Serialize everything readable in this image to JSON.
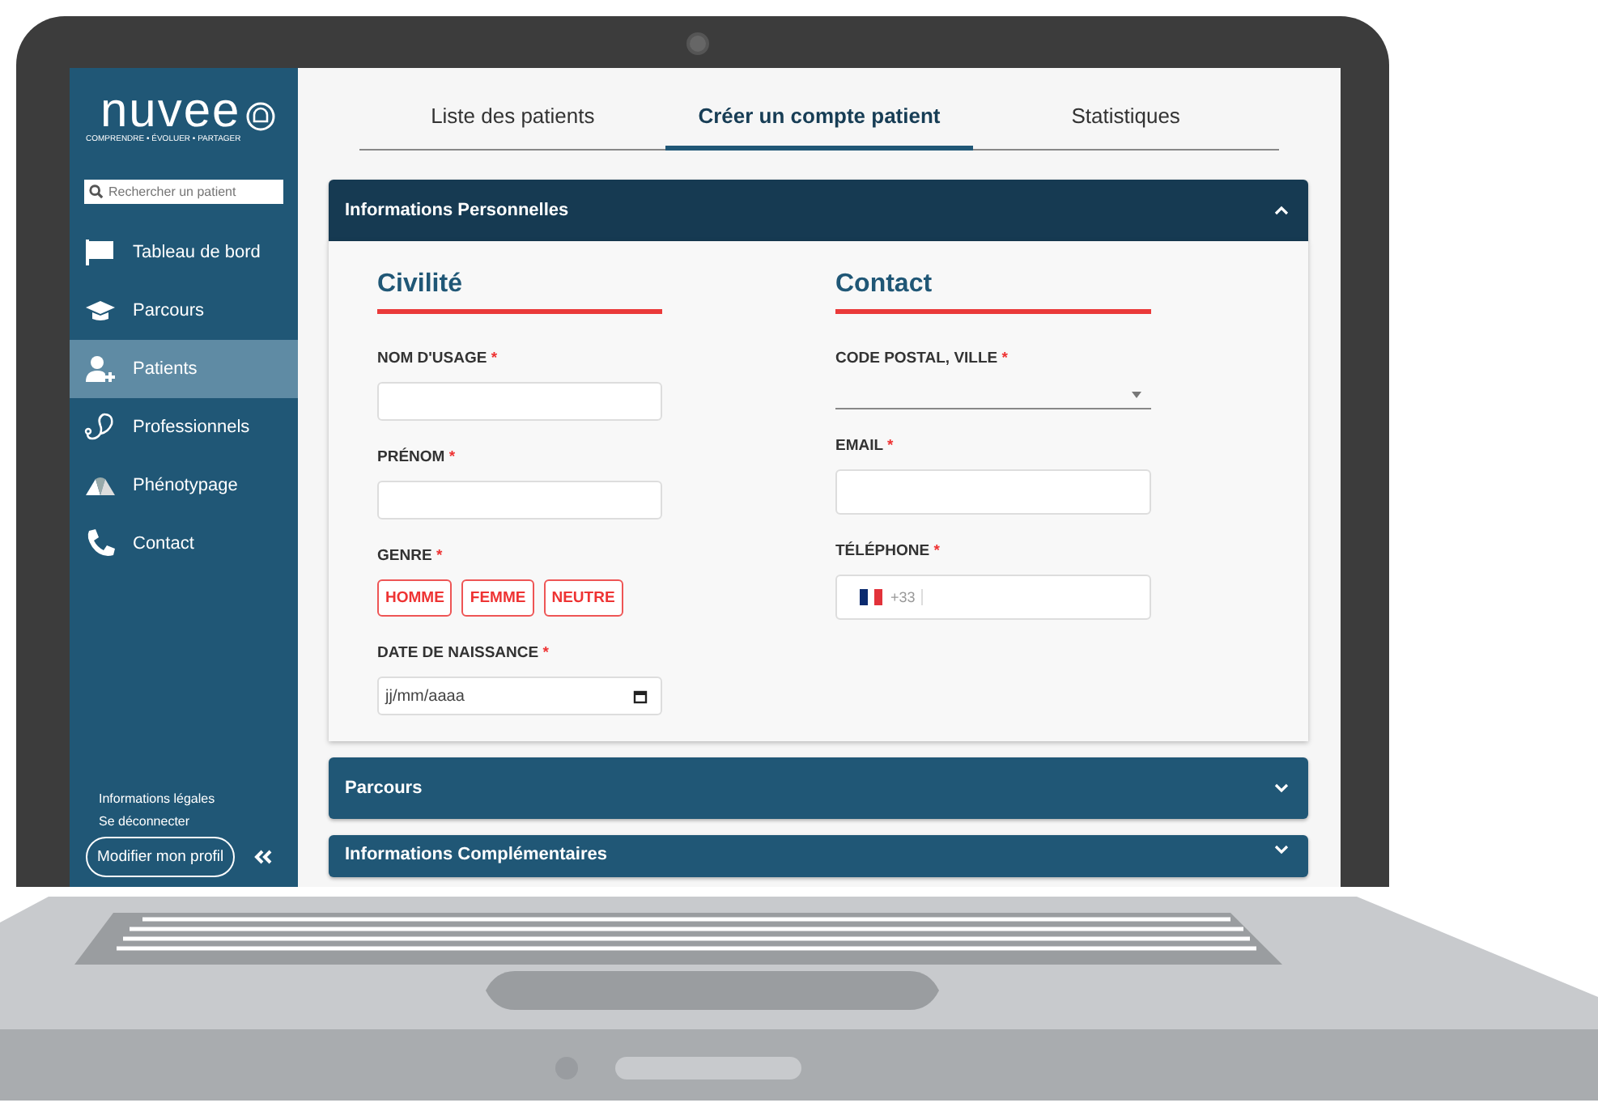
{
  "sidebar": {
    "logo": "nuvee",
    "tagline": "COMPRENDRE • ÉVOLUER • PARTAGER",
    "search": {
      "placeholder": "Rechercher un patient"
    },
    "items": [
      {
        "label": "Tableau de bord",
        "selected": false
      },
      {
        "label": "Parcours",
        "selected": false
      },
      {
        "label": "Patients",
        "selected": true
      },
      {
        "label": "Professionnels",
        "selected": false
      },
      {
        "label": "Phénotypage",
        "selected": false
      },
      {
        "label": "Contact",
        "selected": false
      }
    ],
    "links": [
      "Informations légales",
      "Se déconnecter"
    ],
    "profile_button": "Modifier mon profil"
  },
  "tabs": [
    {
      "label": "Liste des patients",
      "selected": false
    },
    {
      "label": "Créer un compte patient",
      "selected": true
    },
    {
      "label": "Statistiques",
      "selected": false
    }
  ],
  "sections": [
    {
      "title": "Informations Personnelles",
      "expanded": true
    },
    {
      "title": "Parcours",
      "expanded": false
    },
    {
      "title": "Informations Complémentaires",
      "expanded": false
    }
  ],
  "form": {
    "columns": [
      {
        "heading": "Civilité",
        "fields": [
          {
            "kind": "text",
            "label": "NOM D'USAGE",
            "mark": "*"
          },
          {
            "kind": "text",
            "label": "PRÉNOM",
            "mark": "*"
          },
          {
            "kind": "choice",
            "label": "GENRE",
            "mark": "*",
            "options": [
              {
                "label": "HOMME",
                "selected": false
              },
              {
                "label": "FEMME",
                "selected": false
              },
              {
                "label": "NEUTRE",
                "selected": false
              }
            ]
          },
          {
            "kind": "date",
            "label": "DATE DE NAISSANCE",
            "mark": "*",
            "placeholder": "jj/mm/aaaa"
          }
        ]
      },
      {
        "heading": "Contact",
        "fields": [
          {
            "kind": "select",
            "label": "CODE POSTAL, VILLE",
            "mark": "*"
          },
          {
            "kind": "text",
            "label": "EMAIL",
            "mark": "*"
          },
          {
            "kind": "phone",
            "label": "TÉLÉPHONE",
            "mark": "*",
            "prefix": "+33"
          }
        ]
      }
    ]
  }
}
